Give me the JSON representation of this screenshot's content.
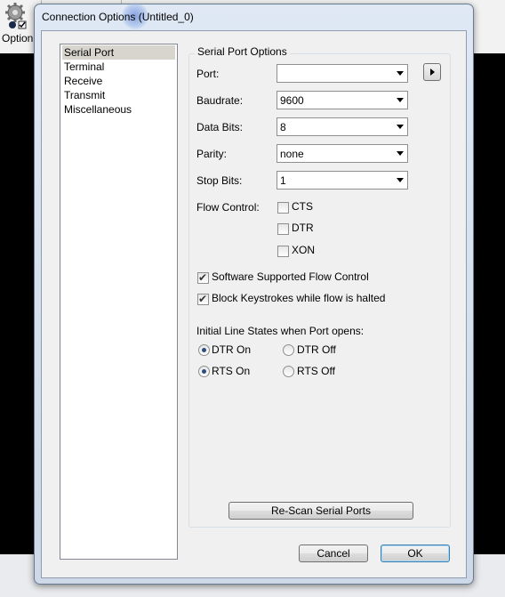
{
  "background": {
    "toolbar_label": "Option"
  },
  "dialog": {
    "title": "Connection Options (Untitled_0)"
  },
  "categories": [
    {
      "label": "Serial Port",
      "selected": true
    },
    {
      "label": "Terminal",
      "selected": false
    },
    {
      "label": "Receive",
      "selected": false
    },
    {
      "label": "Transmit",
      "selected": false
    },
    {
      "label": "Miscellaneous",
      "selected": false
    }
  ],
  "serial_port": {
    "group_title": "Serial Port Options",
    "port": {
      "label": "Port:",
      "value": ""
    },
    "baudrate": {
      "label": "Baudrate:",
      "value": "9600"
    },
    "data_bits": {
      "label": "Data Bits:",
      "value": "8"
    },
    "parity": {
      "label": "Parity:",
      "value": "none"
    },
    "stop_bits": {
      "label": "Stop Bits:",
      "value": "1"
    },
    "flow_control": {
      "label": "Flow Control:",
      "cts": {
        "label": "CTS",
        "checked": false
      },
      "dtr": {
        "label": "DTR",
        "checked": false
      },
      "xon": {
        "label": "XON",
        "checked": false
      }
    },
    "software_flow": {
      "label": "Software Supported Flow Control",
      "checked": true
    },
    "block_keystrokes": {
      "label": "Block Keystrokes while flow is halted",
      "checked": true
    },
    "line_states": {
      "title": "Initial Line States when Port opens:",
      "dtr_on": {
        "label": "DTR On",
        "selected": true
      },
      "dtr_off": {
        "label": "DTR Off",
        "selected": false
      },
      "rts_on": {
        "label": "RTS On",
        "selected": true
      },
      "rts_off": {
        "label": "RTS Off",
        "selected": false
      }
    },
    "rescan_label": "Re-Scan Serial Ports"
  },
  "buttons": {
    "cancel": "Cancel",
    "ok": "OK"
  },
  "colors": {
    "selection": "#d8d5cf",
    "default_button_border": "#3c7fb1",
    "radio_dot": "#2a4e7e"
  },
  "icons": [
    "gear-icon",
    "dropdown-arrow-icon",
    "right-arrow-icon",
    "checkmark-icon"
  ]
}
